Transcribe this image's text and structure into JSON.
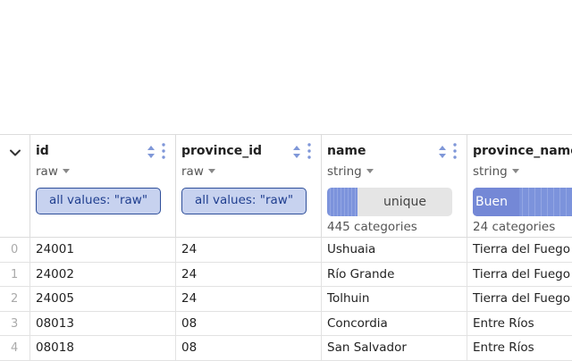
{
  "columns": [
    {
      "name": "id",
      "type": "raw",
      "summary_kind": "all_values",
      "summary_label": "all values: \"raw\"",
      "categories_label": ""
    },
    {
      "name": "province_id",
      "type": "raw",
      "summary_kind": "all_values",
      "summary_label": "all values: \"raw\"",
      "categories_label": ""
    },
    {
      "name": "name",
      "type": "string",
      "summary_kind": "unique",
      "summary_label": "unique",
      "categories_label": "445 categories"
    },
    {
      "name": "province_name",
      "type": "string",
      "summary_kind": "histogram",
      "summary_label": "Buen",
      "categories_label": "24 categories"
    }
  ],
  "rows": [
    {
      "index": "0",
      "id": "24001",
      "province_id": "24",
      "name": "Ushuaia",
      "province_name": "Tierra del Fuego"
    },
    {
      "index": "1",
      "id": "24002",
      "province_id": "24",
      "name": "Río Grande",
      "province_name": "Tierra del Fuego"
    },
    {
      "index": "2",
      "id": "24005",
      "province_id": "24",
      "name": "Tolhuin",
      "province_name": "Tierra del Fuego"
    },
    {
      "index": "3",
      "id": "08013",
      "province_id": "08",
      "name": "Concordia",
      "province_name": "Entre Ríos"
    },
    {
      "index": "4",
      "id": "08018",
      "province_id": "08",
      "name": "San Salvador",
      "province_name": "Entre Ríos"
    }
  ],
  "colors": {
    "accent": "#2f4f9a",
    "pill_bg": "#c7d2ef",
    "histogram_bar": "#7c93dc"
  }
}
